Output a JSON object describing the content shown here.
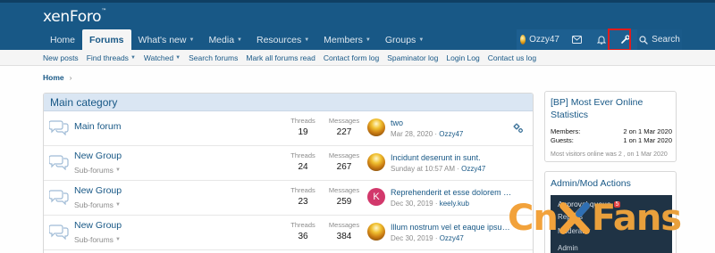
{
  "header": {
    "logo": "xenForo",
    "logo_mark": "™",
    "nav": [
      {
        "label": "Home",
        "caret": false
      },
      {
        "label": "Forums",
        "caret": false,
        "active": true
      },
      {
        "label": "What's new",
        "caret": true
      },
      {
        "label": "Media",
        "caret": true
      },
      {
        "label": "Resources",
        "caret": true
      },
      {
        "label": "Members",
        "caret": true
      },
      {
        "label": "Groups",
        "caret": true
      }
    ],
    "user": "Ozzy47",
    "search_label": "Search"
  },
  "subnav": [
    {
      "label": "New posts",
      "caret": false
    },
    {
      "label": "Find threads",
      "caret": true
    },
    {
      "label": "Watched",
      "caret": true
    },
    {
      "label": "Search forums",
      "caret": false
    },
    {
      "label": "Mark all forums read",
      "caret": false
    },
    {
      "label": "Contact form log",
      "caret": false
    },
    {
      "label": "Spaminator log",
      "caret": false
    },
    {
      "label": "Login Log",
      "caret": false
    },
    {
      "label": "Contact us log",
      "caret": false
    }
  ],
  "breadcrumb": {
    "home": "Home",
    "sep": "›"
  },
  "category": {
    "title": "Main category",
    "nodes": [
      {
        "title": "Main forum",
        "sub": "",
        "threads_label": "Threads",
        "threads": "19",
        "messages_label": "Messages",
        "messages": "227",
        "latest_title": "two",
        "latest_date": "Mar 28, 2020",
        "latest_user": "Ozzy47"
      },
      {
        "title": "New Group",
        "sub": "Sub-forums",
        "threads_label": "Threads",
        "threads": "24",
        "messages_label": "Messages",
        "messages": "267",
        "latest_title": "Incidunt deserunt in sunt.",
        "latest_date": "Sunday at 10:57 AM",
        "latest_user": "Ozzy47"
      },
      {
        "title": "New Group",
        "sub": "Sub-forums",
        "threads_label": "Threads",
        "threads": "23",
        "messages_label": "Messages",
        "messages": "259",
        "latest_title": "Reprehenderit et esse dolorem del...",
        "latest_date": "Dec 30, 2019",
        "latest_user": "keely.kub",
        "avatar_letter": "K"
      },
      {
        "title": "New Group",
        "sub": "Sub-forums",
        "threads_label": "Threads",
        "threads": "36",
        "messages_label": "Messages",
        "messages": "384",
        "latest_title": "Illum nostrum vel et eaque ipsum o...",
        "latest_date": "Dec 30, 2019",
        "latest_user": "Ozzy47"
      }
    ]
  },
  "sidebar": {
    "online_title": "[BP] Most Ever Online Statistics",
    "rows": [
      {
        "label": "Members:",
        "value": "2 on 1 Mar 2020"
      },
      {
        "label": "Guests:",
        "value": "1 on 1 Mar 2020"
      }
    ],
    "footer": "Most visitors online was 2 , on 1 Mar 2020",
    "admin_title": "Admin/Mod Actions",
    "approval_label": "Approval queue",
    "approval_count": "5",
    "dark_rows": [
      "Reports",
      "Moderator",
      "Admin"
    ]
  },
  "watermark": {
    "part1": "Cn",
    "part2": "Fans"
  },
  "colors": {
    "header": "#185886",
    "link": "#185886",
    "highlight": "#e11c1c"
  }
}
